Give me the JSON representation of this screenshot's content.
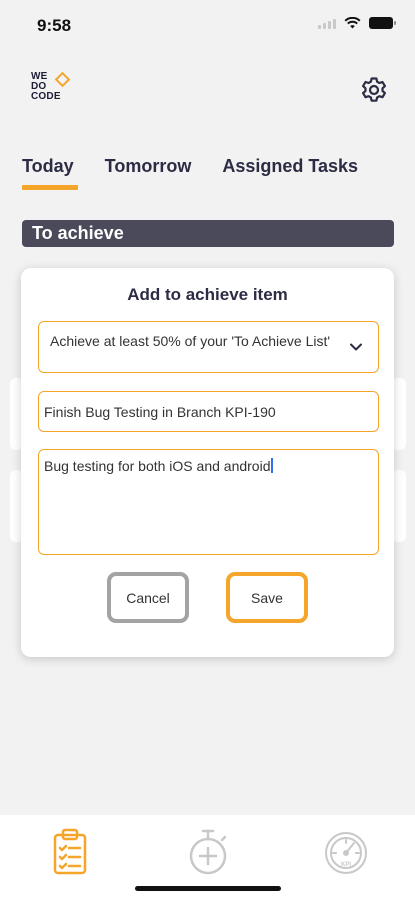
{
  "status_bar": {
    "time": "9:58"
  },
  "header": {
    "logo_line1": "WE",
    "logo_line2": "DO",
    "logo_line3": "CODE",
    "settings_icon": "gear-icon"
  },
  "tabs": [
    {
      "label": "Today",
      "active": true
    },
    {
      "label": "Tomorrow",
      "active": false
    },
    {
      "label": "Assigned Tasks",
      "active": false
    }
  ],
  "section": {
    "title": "To achieve"
  },
  "modal": {
    "title": "Add to achieve item",
    "select_value": "Achieve at least 50% of your 'To Achieve List'",
    "title_value": "Finish Bug Testing in Branch KPI-190",
    "description_value": "Bug testing for both iOS and android",
    "cancel_label": "Cancel",
    "save_label": "Save"
  },
  "bottom_nav": [
    {
      "icon": "clipboard-checklist-icon",
      "active": true
    },
    {
      "icon": "stopwatch-plus-icon",
      "active": false
    },
    {
      "icon": "kpi-gauge-icon",
      "active": false
    }
  ],
  "colors": {
    "accent": "#f4a52a",
    "section_bar": "#4a4a5a",
    "inactive": "#c8c8c8"
  }
}
